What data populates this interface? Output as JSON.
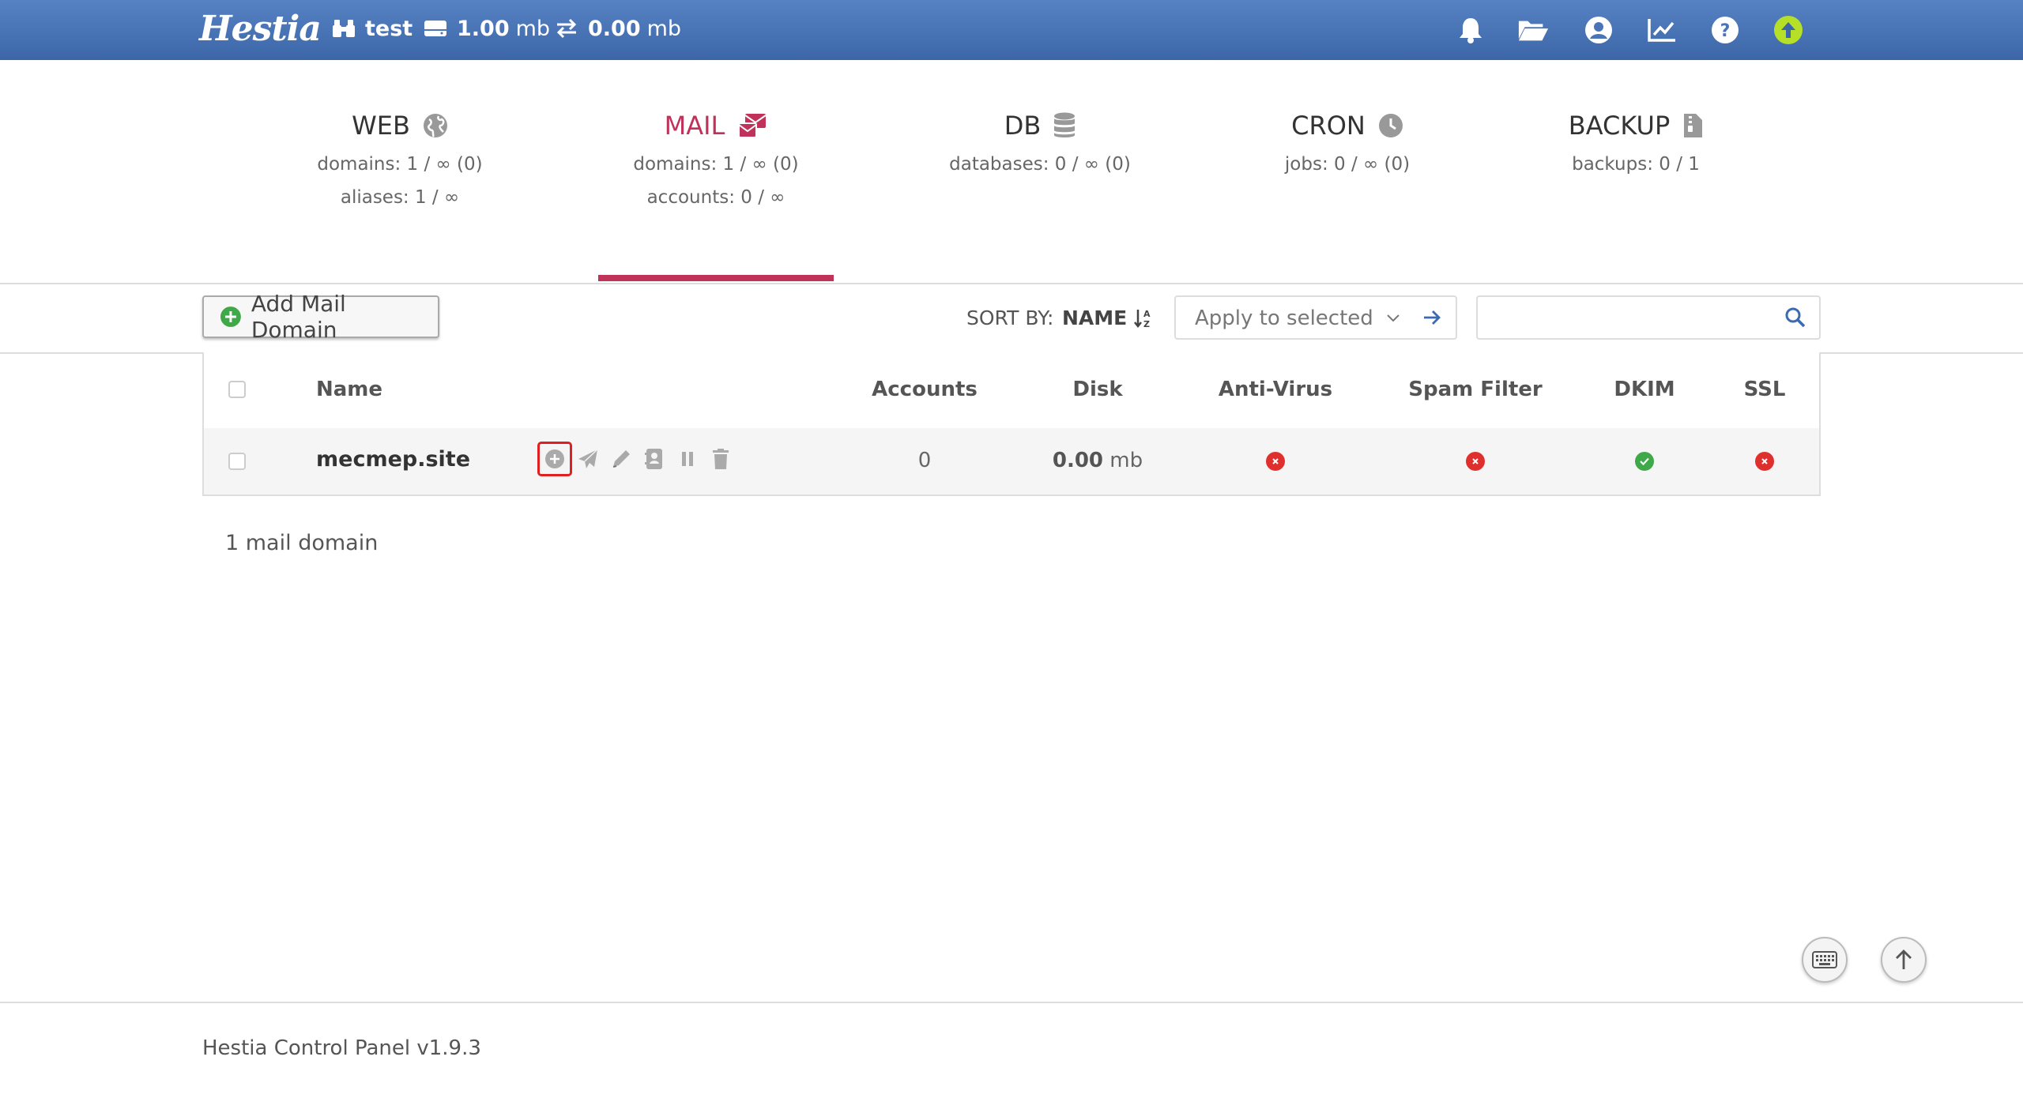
{
  "topbar": {
    "logo": "Hestia",
    "user": "test",
    "disk": "1.00",
    "disk_unit": "mb",
    "bandwidth": "0.00",
    "bandwidth_unit": "mb",
    "icons": [
      "bell-icon",
      "folder-open-icon",
      "user-circle-icon",
      "chart-line-icon",
      "help-icon",
      "update-icon"
    ]
  },
  "tabs": [
    {
      "title": "WEB",
      "icon": "globe-icon",
      "lines": [
        "domains: 1 / ∞ (0)",
        "aliases: 1 / ∞"
      ]
    },
    {
      "title": "MAIL",
      "icon": "mail-bulk-icon",
      "lines": [
        "domains: 1 / ∞ (0)",
        "accounts: 0 / ∞"
      ],
      "active": true
    },
    {
      "title": "DB",
      "icon": "database-icon",
      "lines": [
        "databases: 0 / ∞ (0)"
      ]
    },
    {
      "title": "CRON",
      "icon": "clock-icon",
      "lines": [
        "jobs: 0 / ∞ (0)"
      ]
    },
    {
      "title": "BACKUP",
      "icon": "file-archive-icon",
      "lines": [
        "backups: 0 / 1"
      ]
    }
  ],
  "toolbar": {
    "add_label": "Add Mail Domain",
    "sort_label": "SORT BY:",
    "sort_value": "NAME",
    "apply_placeholder": "Apply to selected",
    "search_value": ""
  },
  "table": {
    "headers": {
      "name": "Name",
      "accounts": "Accounts",
      "disk": "Disk",
      "antivirus": "Anti-Virus",
      "spam": "Spam Filter",
      "dkim": "DKIM",
      "ssl": "SSL"
    },
    "rows": [
      {
        "domain": "mecmep.site",
        "accounts": "0",
        "disk": "0.00",
        "disk_unit": "mb",
        "antivirus": "disabled",
        "spam": "disabled",
        "dkim": "enabled",
        "ssl": "disabled"
      }
    ]
  },
  "count_text": "1 mail domain",
  "footer": "Hestia Control Panel v1.9.3",
  "colors": {
    "accent": "#c0325a",
    "header": "#4a74b8",
    "enabled": "#3fa849",
    "disabled": "#e0302e"
  }
}
